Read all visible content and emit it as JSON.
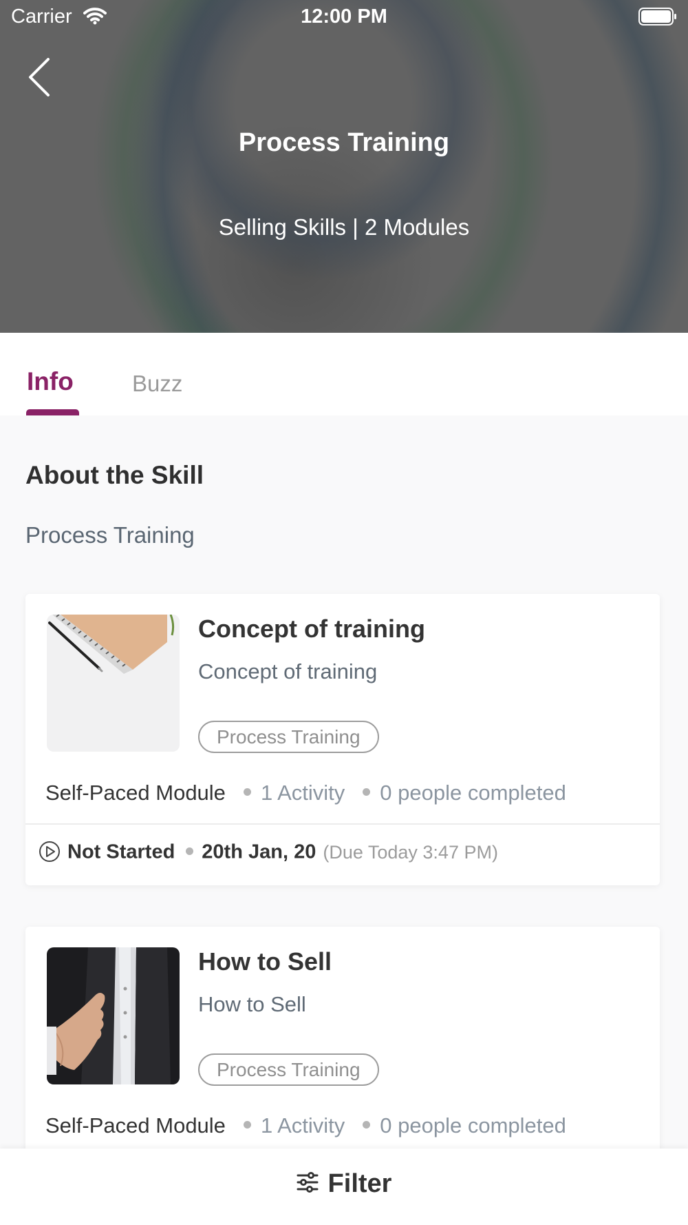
{
  "status_bar": {
    "carrier": "Carrier",
    "time": "12:00 PM"
  },
  "header": {
    "title": "Process Training",
    "subtitle": "Selling Skills | 2 Modules"
  },
  "tabs": [
    {
      "label": "Info",
      "active": true
    },
    {
      "label": "Buzz",
      "active": false
    }
  ],
  "about": {
    "title": "About the Skill",
    "text": "Process Training"
  },
  "modules": [
    {
      "title": "Concept of training",
      "description": "Concept of training",
      "tag": "Process Training",
      "type": "Self-Paced Module",
      "activities": "1 Activity",
      "completed": "0 people completed",
      "status": "Not Started",
      "date": "20th Jan, 20",
      "due": "(Due Today 3:47 PM)",
      "thumbnail_icon": "notebook-pen-image"
    },
    {
      "title": "How to Sell",
      "description": "How to Sell",
      "tag": "Process Training",
      "type": "Self-Paced Module",
      "activities": "1 Activity",
      "completed": "0 people completed",
      "thumbnail_icon": "handshake-image"
    }
  ],
  "filter": {
    "label": "Filter"
  },
  "colors": {
    "accent": "#8a2266",
    "text": "#333333",
    "muted": "#9a9a9a"
  }
}
